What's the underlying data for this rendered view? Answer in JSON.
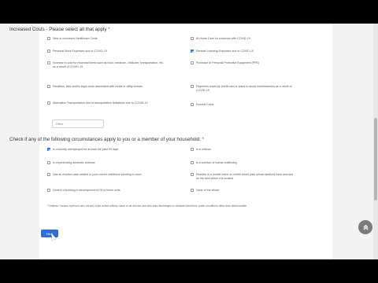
{
  "section1": {
    "title": "Increased Costs - Please select all that apply",
    "required_mark": "*",
    "options": [
      {
        "label": "New or Increased Healthcare Costs",
        "checked": false
      },
      {
        "label": "At Home Care for someone with COVID-19",
        "checked": false
      },
      {
        "label": "Personal Work Expenses due to COVID-19",
        "checked": false
      },
      {
        "label": "Remote Learning Expenses due to COVID-19",
        "checked": true
      },
      {
        "label": "Increase in cost for essential items such as food, medicine, childcare, transportation, etc. as a result of COVID-19",
        "checked": false
      },
      {
        "label": "Purchase of Personal Protective Equipment (PPE)",
        "checked": false
      },
      {
        "label": "Penalties, fees and/or legal costs associated with rental or utility arrears",
        "checked": false
      },
      {
        "label": "Payments made by credit card or loans to avoid homelessness as a result of COVID-19",
        "checked": false
      },
      {
        "label": "Alternative Transportation due to transportation limitations due to COVID-19",
        "checked": false
      },
      {
        "label": "Funeral Costs",
        "checked": false
      }
    ],
    "other_placeholder": "Other"
  },
  "section2": {
    "title": "Check if any of the following circumstances apply to you or a member of your household:",
    "required_mark": "*",
    "options": [
      {
        "label": "Is currently unemployed for at least the past 90 days",
        "checked": true
      },
      {
        "label": "Is a veteran",
        "checked": false
      },
      {
        "label": "Is experiencing domestic violence",
        "checked": false
      },
      {
        "label": "Is a survivor of human trafficking",
        "checked": false
      },
      {
        "label": "Has an eviction case related to your current residence pending in court",
        "checked": false
      },
      {
        "label": "Resides in a mobile home or mobile home park whose landlord have accrued on the land which it is located",
        "checked": false
      },
      {
        "label": "Lives in a building in development of 20 or fewer units",
        "checked": false
      },
      {
        "label": "None of the above",
        "checked": false
      }
    ]
  },
  "footnote": "**Veteran\" means a person who served in the active military naval or air service and who was discharged or released therefrom under conditions other than dishonorable.",
  "next_label": "Next",
  "scroll_top_icon": "double-chevron-up-icon",
  "colors": {
    "accent": "#2f6fd6",
    "required": "#c0392b"
  }
}
